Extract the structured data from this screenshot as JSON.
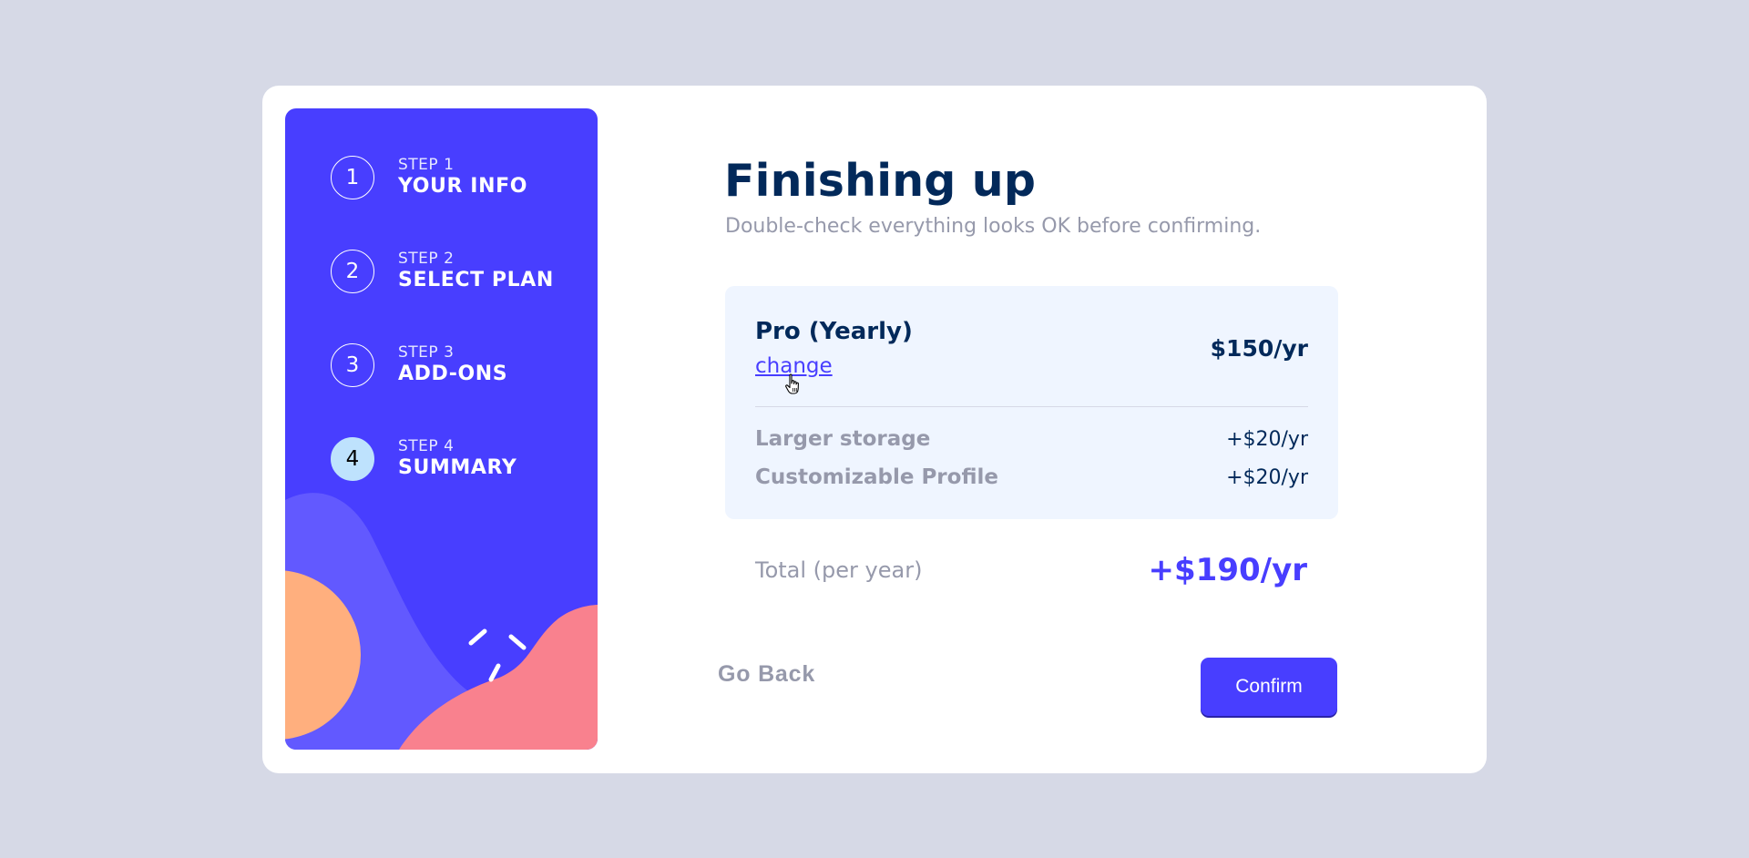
{
  "sidebar": {
    "steps": [
      {
        "number": "1",
        "step_label": "STEP 1",
        "name": "YOUR INFO",
        "active": false
      },
      {
        "number": "2",
        "step_label": "STEP 2",
        "name": "SELECT PLAN",
        "active": false
      },
      {
        "number": "3",
        "step_label": "STEP 3",
        "name": "ADD-ONS",
        "active": false
      },
      {
        "number": "4",
        "step_label": "STEP 4",
        "name": "SUMMARY",
        "active": true
      }
    ]
  },
  "main": {
    "title": "Finishing up",
    "subtitle": "Double-check everything looks OK before confirming.",
    "plan": {
      "name": "Pro (Yearly)",
      "change_label": "change",
      "price": "$150/yr"
    },
    "addons": [
      {
        "name": "Larger storage",
        "price": "+$20/yr"
      },
      {
        "name": "Customizable Profile",
        "price": "+$20/yr"
      }
    ],
    "total": {
      "label": "Total (per year)",
      "price": "+$190/yr"
    },
    "go_back_label": "Go Back",
    "confirm_label": "Confirm"
  },
  "colors": {
    "page_bg": "#d6d9e6",
    "sidebar_bg": "#483eff",
    "active_step": "#bee2fd",
    "marine_blue": "#02295a",
    "purplish_blue": "#483eff",
    "cool_gray": "#9699ab",
    "summary_bg": "#eff5ff"
  }
}
